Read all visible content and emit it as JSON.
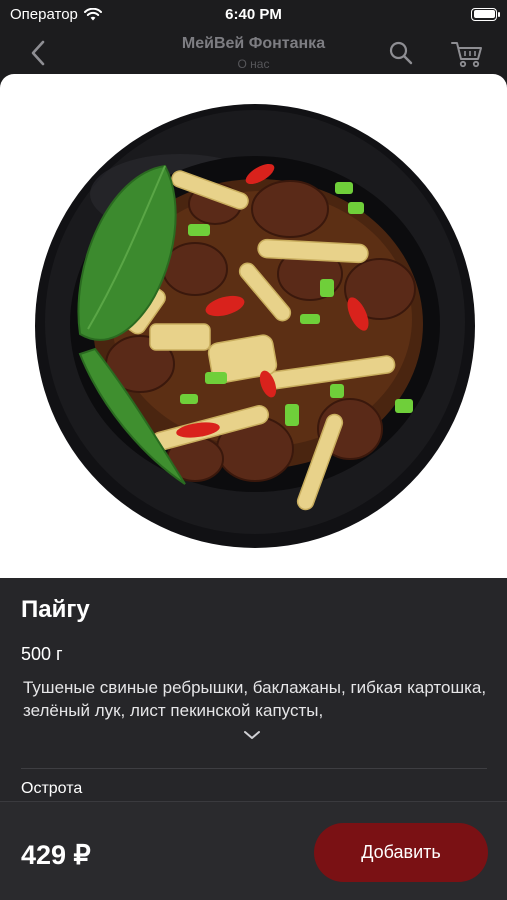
{
  "status_bar": {
    "carrier": "Оператор",
    "time": "6:40 PM"
  },
  "nav": {
    "title": "МейВей Фонтанка",
    "subtitle": "О нас",
    "back_icon": "chevron-left-icon",
    "search_icon": "search-icon",
    "cart_icon": "cart-icon"
  },
  "product": {
    "image_alt": "Пайгу",
    "name": "Пайгу",
    "weight": "500 г",
    "description": "Тушеные свиные ребрышки, баклажаны, гибкая картошка, зелёный лук, лист пекинской капусты,",
    "spice_label": "Острота",
    "price": "429 ₽",
    "add_label": "Добавить"
  },
  "colors": {
    "background": "#1c1c1e",
    "panel": "#262629",
    "accent": "#7a1114",
    "nav_text": "#7d7d82"
  }
}
